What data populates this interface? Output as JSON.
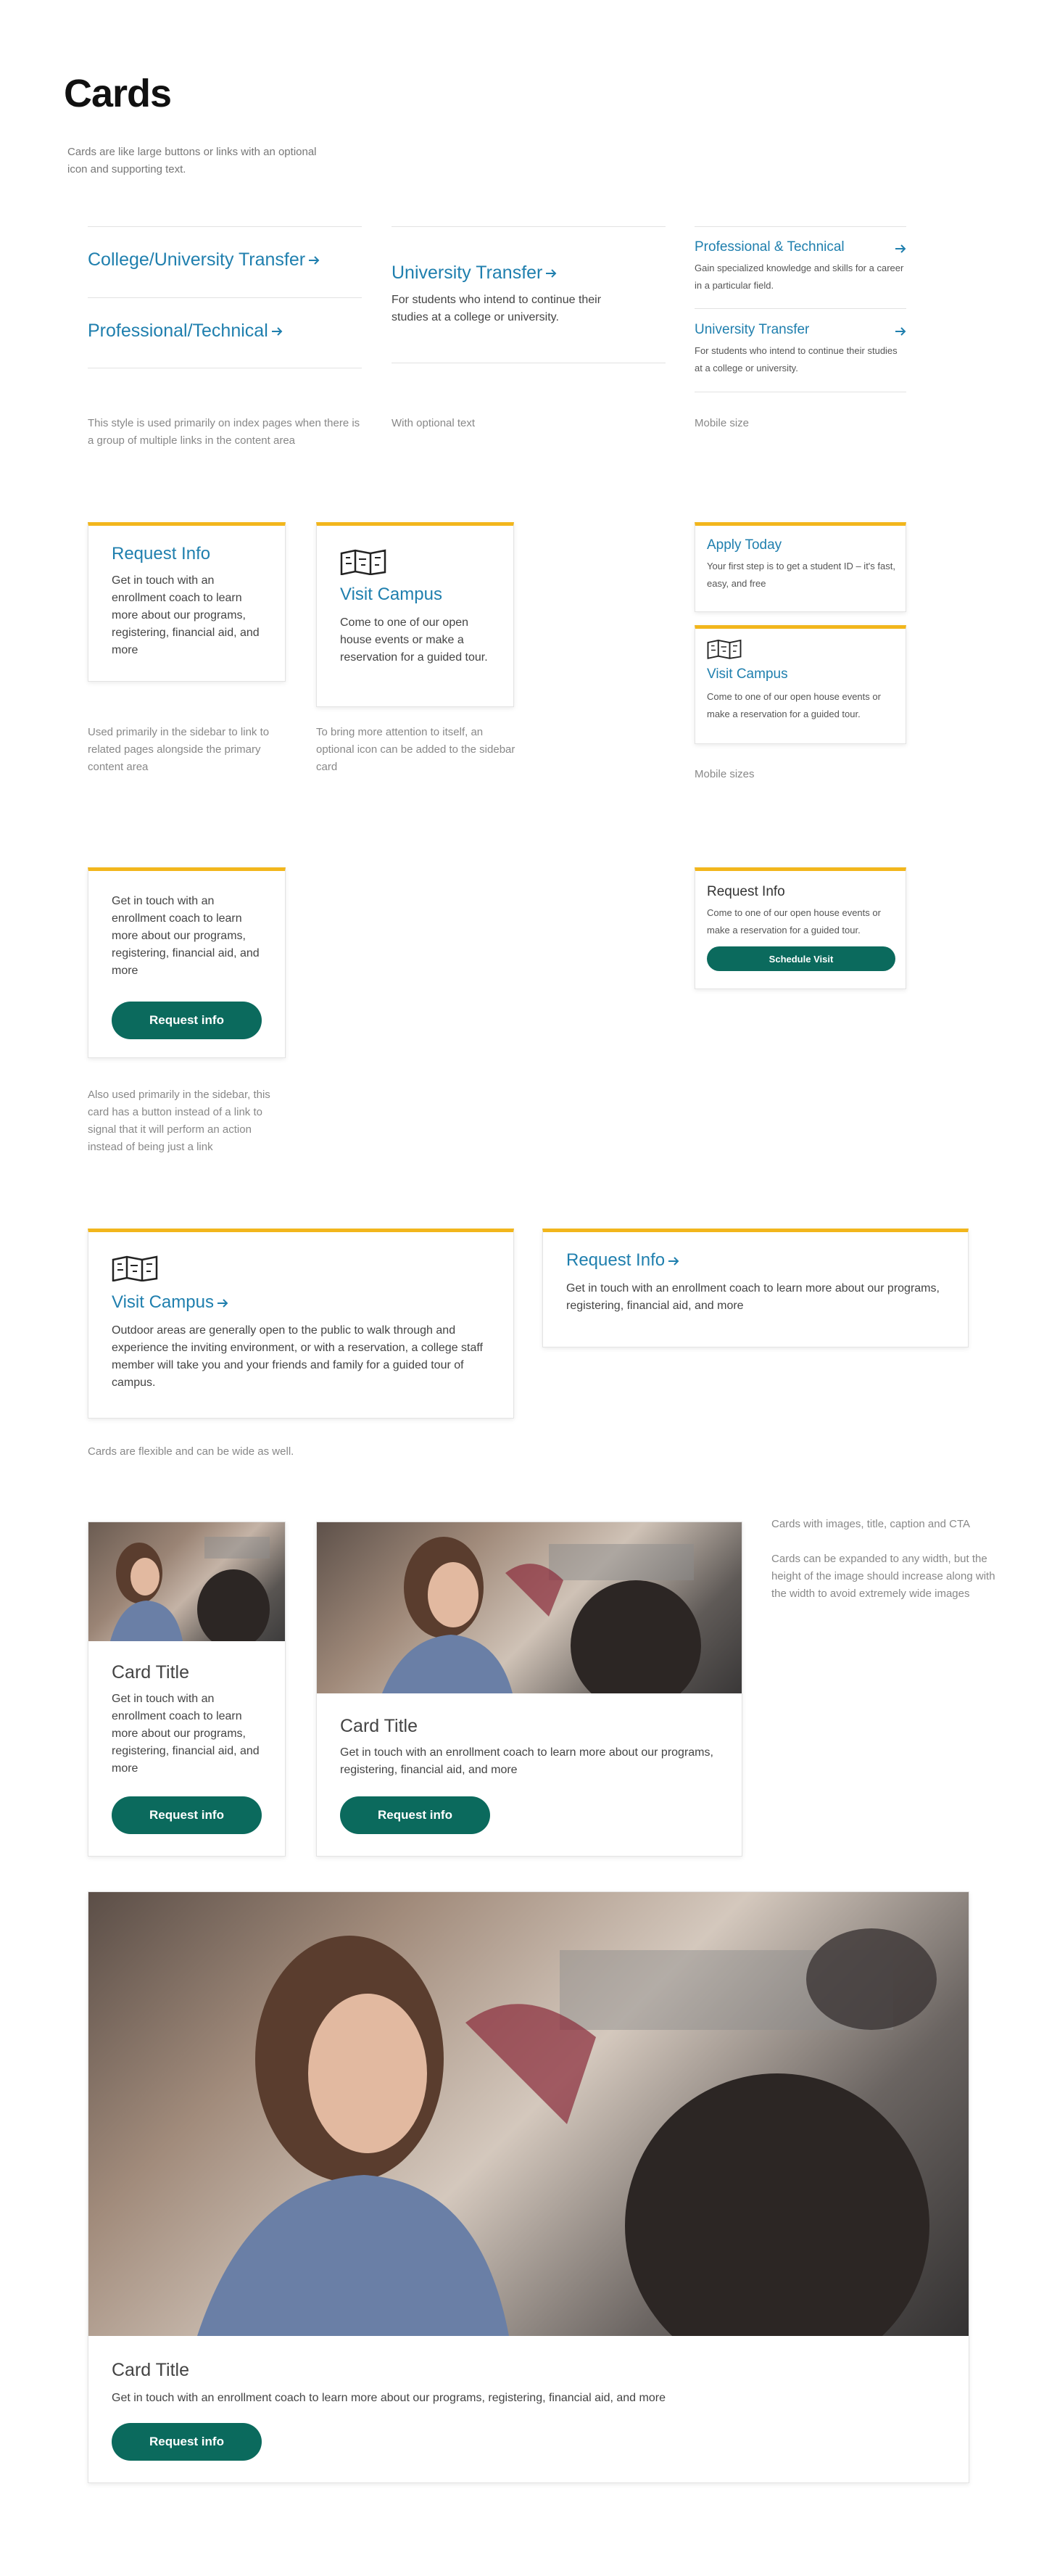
{
  "page": {
    "title": "Cards",
    "description": "Cards are like large buttons or links with an optional icon and supporting text."
  },
  "linklist": {
    "items": [
      {
        "label": "College/University Transfer"
      },
      {
        "label": "Professional/Technical"
      }
    ],
    "note": "This style is used primarily on index pages when there is a group of multiple links in the content area"
  },
  "optional": {
    "title": "University Transfer",
    "text": "For students who intend to continue their studies at a college or university.",
    "note": "With optional text"
  },
  "mobile_links": {
    "items": [
      {
        "title": "Professional & Technical",
        "text": "Gain specialized knowledge and skills for a career in a particular field."
      },
      {
        "title": "University Transfer",
        "text": "For students who intend to continue their studies at a college or university."
      }
    ],
    "note": "Mobile size"
  },
  "sidebar_cards": {
    "request": {
      "title": "Request Info",
      "text": "Get in touch with an enrollment coach to learn more about our programs, registering, financial aid, and more",
      "note": "Used primarily in the sidebar to link to related pages alongside the primary content area"
    },
    "visit": {
      "icon": "map-icon",
      "title": "Visit Campus",
      "text": "Come to one of our open house events or make a reservation for a guided tour.",
      "note": "To bring more attention to itself, an optional icon can be added to the sidebar card"
    }
  },
  "mobile_cards": {
    "apply": {
      "title": "Apply Today",
      "text": "Your first step is to get a student ID – it's fast, easy, and free"
    },
    "visit": {
      "icon": "map-icon",
      "title": "Visit Campus",
      "text": "Come to one of our open house events or make a reservation for a guided tour."
    },
    "note": "Mobile sizes"
  },
  "button_card": {
    "text": "Get in touch with an enrollment coach to learn more about our programs, registering, financial aid, and more",
    "button": "Request info",
    "note": "Also used primarily in the sidebar, this card has a button instead of a link to signal that it will perform an action instead of being just a link"
  },
  "button_card_mobile": {
    "title": "Request Info",
    "text": "Come to one of our open house events or make a reservation for a guided tour.",
    "button": "Schedule Visit"
  },
  "wide_cards": {
    "visit": {
      "icon": "map-icon",
      "title": "Visit Campus",
      "text": "Outdoor areas are generally open to the public to walk through and experience the inviting environment, or with a reservation, a college staff member will take you and your friends and family for a guided tour of campus."
    },
    "request": {
      "title": "Request Info",
      "text": "Get in touch with an enrollment coach to learn more about our programs, registering, financial aid, and more"
    },
    "note": "Cards are flexible and can be wide as well."
  },
  "image_cards": {
    "small": {
      "title": "Card Title",
      "text": "Get in touch with an enrollment coach to learn more about our programs, registering, financial aid, and more",
      "button": "Request info"
    },
    "medium": {
      "title": "Card Title",
      "text": "Get in touch with an enrollment coach to learn more about our programs, registering, financial aid, and more",
      "button": "Request info"
    },
    "note1": "Cards with images, title, caption and CTA",
    "note2": "Cards can be expanded to any width, but the height of the image should increase along with the width to avoid extremely wide images",
    "large": {
      "title": "Card Title",
      "text": "Get in touch with an enrollment coach to learn more about our programs, registering, financial aid, and more",
      "button": "Request info"
    }
  },
  "colors": {
    "accent": "#f2b61c",
    "link": "#1f7fae",
    "button": "#0b6a5d"
  }
}
